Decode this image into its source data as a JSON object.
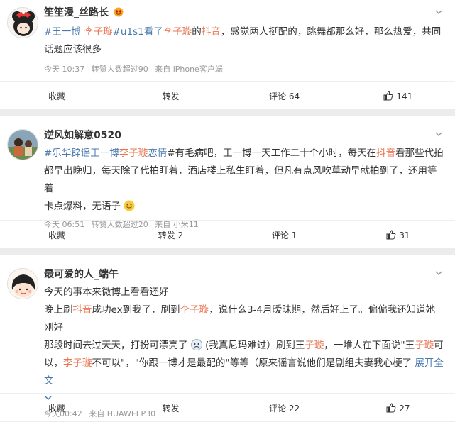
{
  "posts": [
    {
      "username": "笙笙漫_丝路长",
      "content": {
        "t1": "#王一博 ",
        "t2": "李子璇",
        "t3": "#u1s1看了",
        "t4": "李子璇",
        "t5": "的",
        "t6": "抖音",
        "t7": "，感觉两人挺配的，跳舞都那么好，那么热爱，共同",
        "t8": "话题应该很多"
      },
      "time": "今天 10:37",
      "reposts_info": "转赞人数超过90",
      "source": "来自 iPhone客户端",
      "actions": {
        "fav": "收藏",
        "repost": "转发",
        "comment": "评论 64",
        "like": "141"
      }
    },
    {
      "username": "逆风如解意0520",
      "content": {
        "t1": "#乐华辟谣王一博",
        "t2": "李子璇",
        "t3": "恋情",
        "t4": "#有毛病吧，王一博一天工作二十个小时，每天在",
        "t5": "抖音",
        "t6": "看那些代拍",
        "t7": "都早出晚归，每天除了代拍盯着，酒店楼上私生盯着，但凡有点风吹草动早就拍到了，还用等着",
        "t8": "卡点爆料，无语子"
      },
      "time": "今天 06:51",
      "reposts_info": "转赞人数超过20",
      "source": "来自 小米11",
      "actions": {
        "fav": "收藏",
        "repost": "转发 2",
        "comment": "评论 1",
        "like": "31"
      }
    },
    {
      "username": "最可爱的人_端午",
      "content": {
        "l1": "今天的事本来微博上看看还好",
        "l2a": "晚上刷",
        "l2b": "抖音",
        "l2c": "成功ex到我了，刷到",
        "l2d": "李子璇",
        "l2e": "，说什么3-4月暧昧期，然后好上了。偏偏我还知道她刚好",
        "l3a": "那段时间去过天天，打扮可漂亮了",
        "l3b": "(我真尼玛难过）刷到王",
        "l3c": "子璇",
        "l3d": "，一堆人在下面说\"王",
        "l3e": "子璇",
        "l3f": "可",
        "l4a": "以，",
        "l4b": "李子璇",
        "l4c": "不可以\"，\"你跟一博才是最配的\"等等（原来谣言说他们是剧组夫妻我心梗了",
        "l4d": "展开全文"
      },
      "time": "今天00:42",
      "source": "来自 HUAWEI P30",
      "actions": {
        "fav": "收藏",
        "repost": "转发",
        "comment": "评论 22",
        "like": "27"
      }
    }
  ]
}
